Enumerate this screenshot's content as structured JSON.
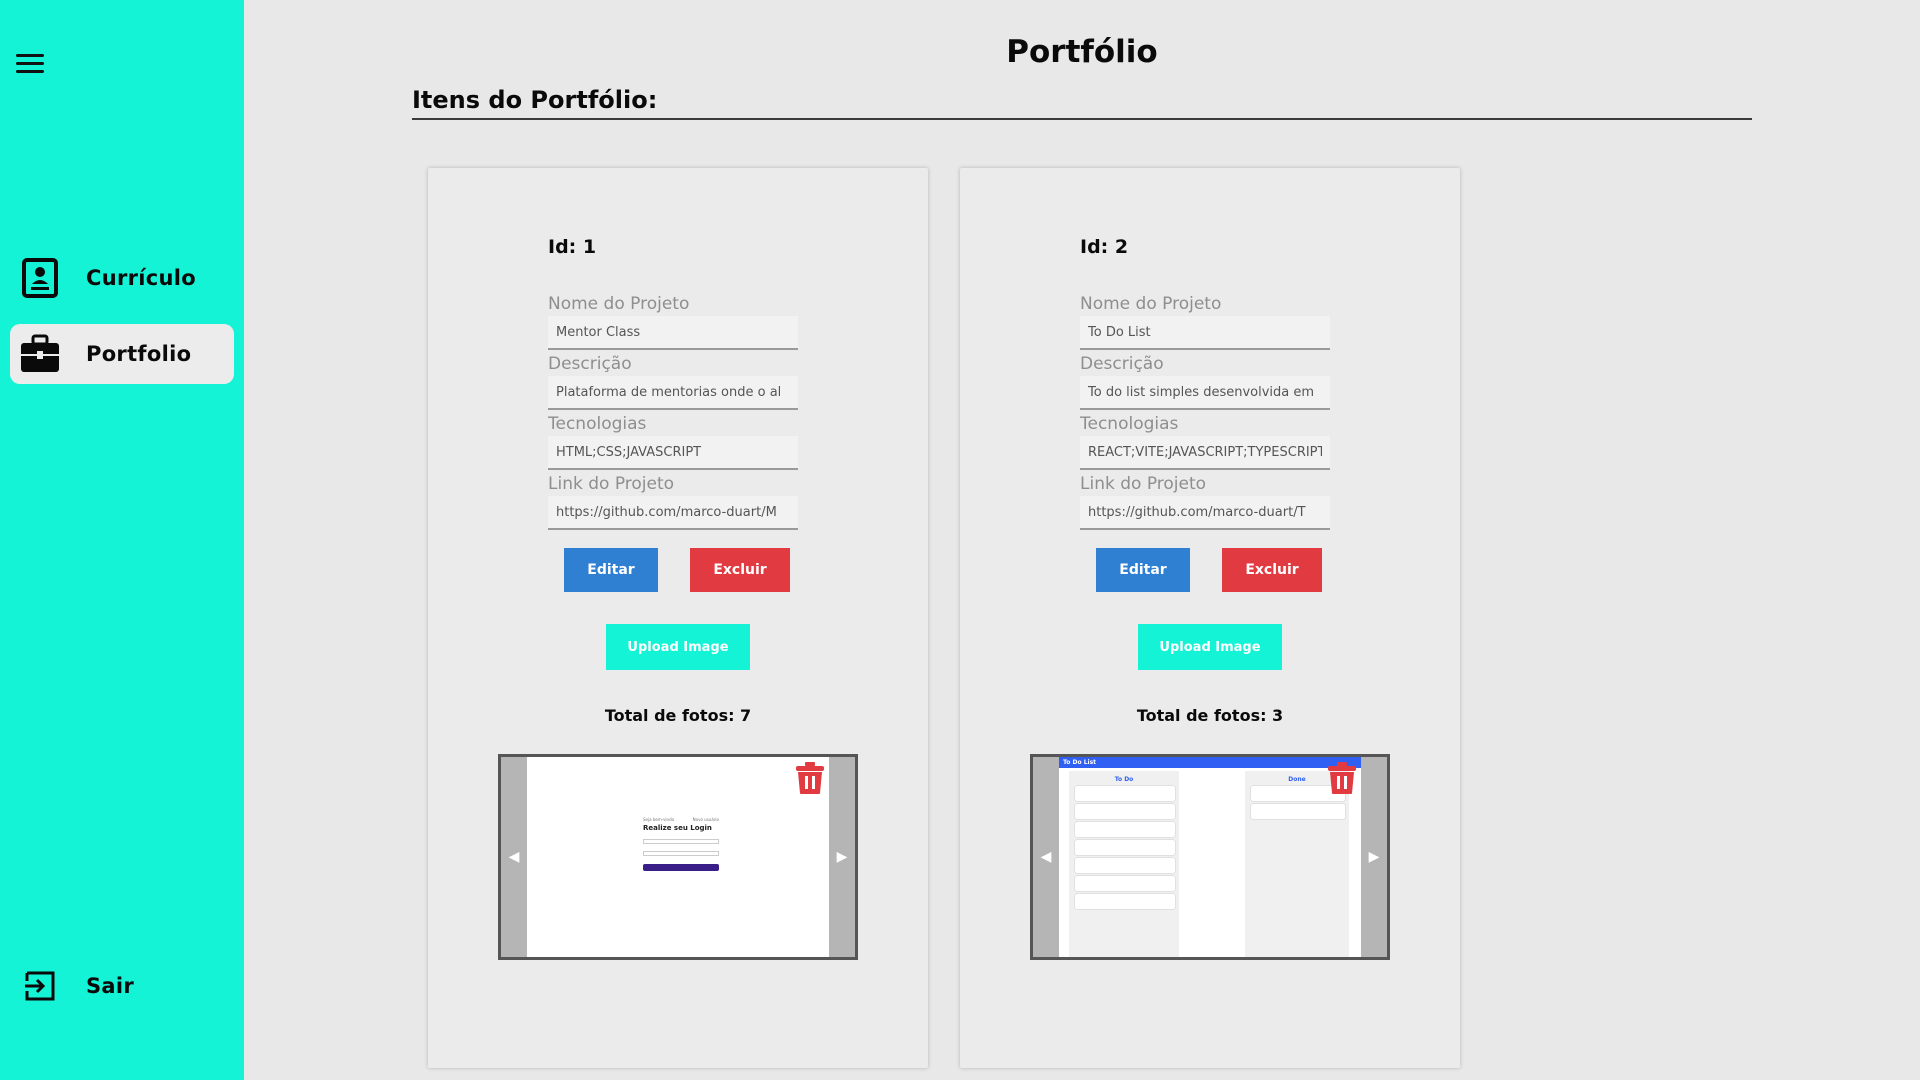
{
  "sidebar": {
    "items": [
      {
        "label": "Currículo",
        "icon": "document-person-icon"
      },
      {
        "label": "Portfolio",
        "icon": "briefcase-icon",
        "active": true
      }
    ],
    "logout_label": "Sair"
  },
  "header": {
    "title": "Portfólio",
    "section_title": "Itens do Portfólio:"
  },
  "labels": {
    "name": "Nome do Projeto",
    "description": "Descrição",
    "technologies": "Tecnologias",
    "link": "Link do Projeto",
    "edit": "Editar",
    "delete": "Excluir",
    "upload": "Upload Image"
  },
  "cards": [
    {
      "id_text": "Id: 1",
      "name": "Mentor Class",
      "description": "Plataforma de mentorias onde o al",
      "technologies": "HTML;CSS;JAVASCRIPT",
      "link": "https://github.com/marco-duart/M",
      "photo_count_text": "Total de fotos: 7",
      "preview": {
        "small_left": "Seja bem-vindo",
        "small_right": "Novo usuário",
        "heading": "Realize seu Login"
      }
    },
    {
      "id_text": "Id: 2",
      "name": "To Do List",
      "description": "To do list simples desenvolvida em",
      "technologies": "REACT;VITE;JAVASCRIPT;TYPESCRIPT;",
      "link": "https://github.com/marco-duart/T",
      "photo_count_text": "Total de fotos: 3",
      "preview": {
        "app_title": "To Do List",
        "col_todo": "To Do",
        "col_done": "Done"
      }
    }
  ],
  "colors": {
    "sidebar": "#14f3d5",
    "edit": "#2f7fd3",
    "delete": "#e23a41",
    "upload": "#14f3d5"
  }
}
